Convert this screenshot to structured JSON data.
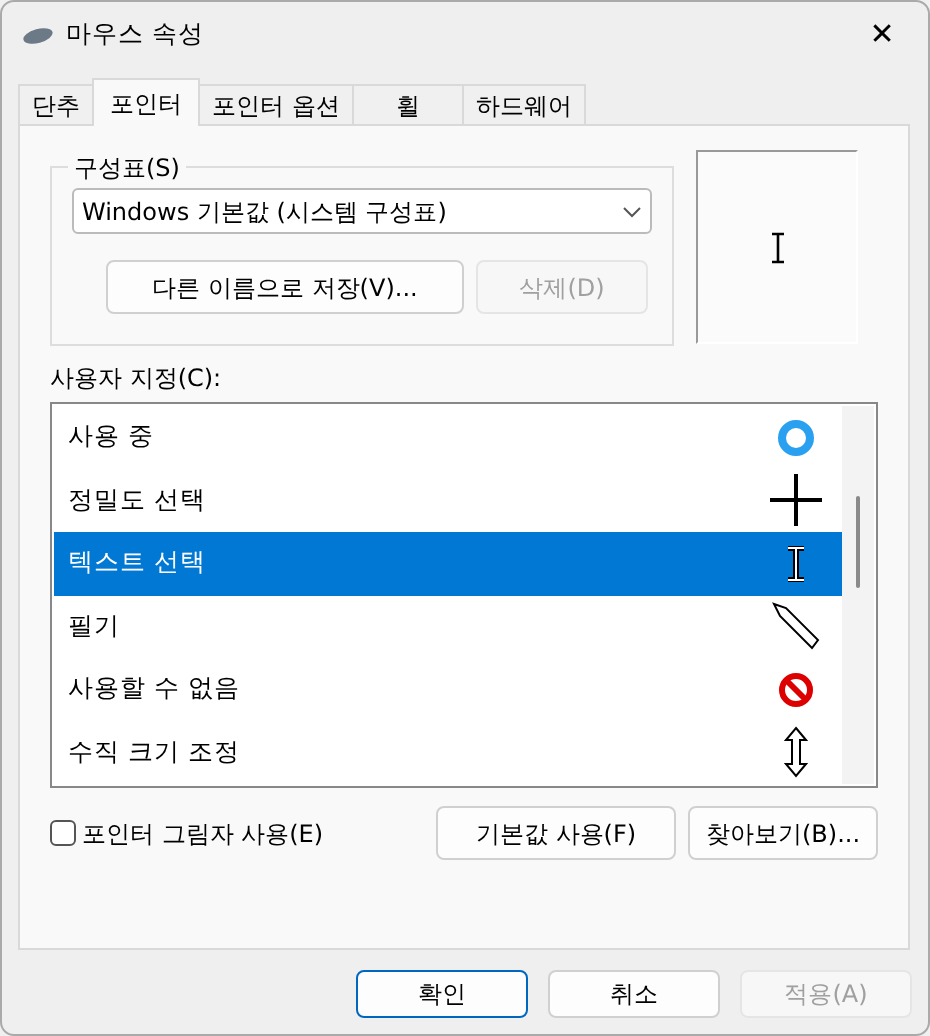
{
  "window": {
    "title": "마우스 속성",
    "close": "✕"
  },
  "tabs": [
    {
      "label": "단추",
      "selected": false
    },
    {
      "label": "포인터",
      "selected": true
    },
    {
      "label": "포인터 옵션",
      "selected": false
    },
    {
      "label": "휠",
      "selected": false
    },
    {
      "label": "하드웨어",
      "selected": false
    }
  ],
  "scheme": {
    "legend": "구성표(S)",
    "value": "Windows 기본값 (시스템 구성표)",
    "save_button": {
      "label": "다른 이름으로 저장(V)...",
      "disabled": false
    },
    "delete_button": {
      "label": "삭제(D)",
      "disabled": true
    }
  },
  "customize": {
    "label": "사용자 지정(C):",
    "items": [
      {
        "label": "사용 중",
        "selected": false
      },
      {
        "label": "정밀도 선택",
        "selected": false
      },
      {
        "label": "텍스트 선택",
        "selected": true
      },
      {
        "label": "필기",
        "selected": false
      },
      {
        "label": "사용할 수 없음",
        "selected": false
      },
      {
        "label": "수직 크기 조정",
        "selected": false
      }
    ]
  },
  "shadow_checkbox": {
    "label": "포인터 그림자 사용(E)",
    "checked": false
  },
  "buttons": [
    {
      "label": "기본값 사용(F)",
      "disabled": false
    },
    {
      "label": "찾아보기(B)...",
      "disabled": false
    }
  ],
  "dialog_buttons": [
    {
      "label": "확인",
      "disabled": false,
      "default": true
    },
    {
      "label": "취소",
      "disabled": false,
      "default": false
    },
    {
      "label": "적용(A)",
      "disabled": true,
      "default": false
    }
  ]
}
